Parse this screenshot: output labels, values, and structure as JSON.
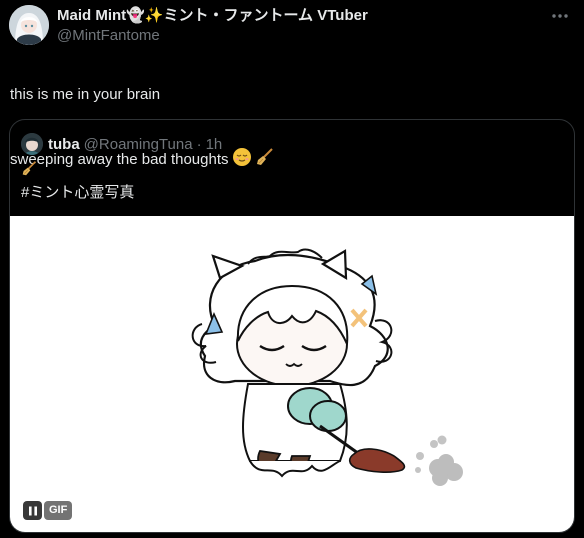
{
  "post": {
    "display_name": "Maid Mint👻✨ミント・ファントーム VTuber",
    "handle": "@MintFantome",
    "text_line1": "this is me in your brain",
    "text_line2": "sweeping away the bad thoughts",
    "emojis": [
      "relieved-face-emoji",
      "broom-emoji"
    ],
    "more_icon": "more-horizontal-icon"
  },
  "quote": {
    "name": "tuba",
    "handle": "@RoamingTuna",
    "separator": "·",
    "time": "1h",
    "line1_emoji": "broom-emoji",
    "hashtag": "#ミント心霊写真",
    "media": {
      "type": "gif",
      "badge": "GIF",
      "pause_icon": "pause-icon"
    }
  },
  "colors": {
    "background": "#000000",
    "text_primary": "#e7e9ea",
    "text_secondary": "#71767b",
    "border": "#2f3336",
    "media_bg": "#ffffff"
  }
}
